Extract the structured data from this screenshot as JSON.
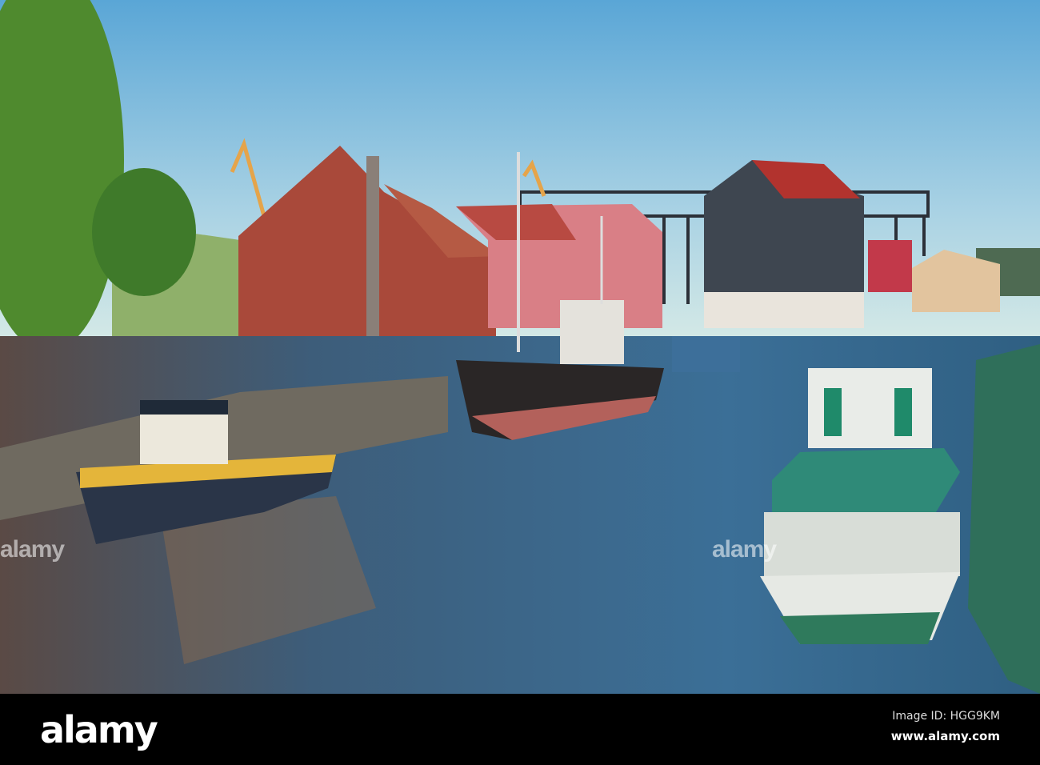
{
  "photo": {
    "watermark_text": "alamy"
  },
  "footer": {
    "logo": "alamy",
    "image_id": "Image ID: HGG9KM",
    "website": "www.alamy.com"
  }
}
